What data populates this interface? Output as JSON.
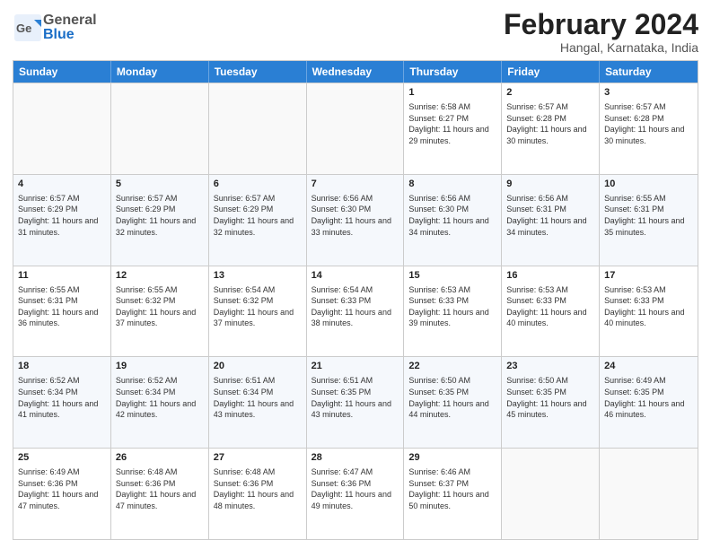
{
  "header": {
    "logo_general": "General",
    "logo_blue": "Blue",
    "month_title": "February 2024",
    "location": "Hangal, Karnataka, India"
  },
  "weekdays": [
    "Sunday",
    "Monday",
    "Tuesday",
    "Wednesday",
    "Thursday",
    "Friday",
    "Saturday"
  ],
  "rows": [
    [
      {
        "day": "",
        "info": ""
      },
      {
        "day": "",
        "info": ""
      },
      {
        "day": "",
        "info": ""
      },
      {
        "day": "",
        "info": ""
      },
      {
        "day": "1",
        "info": "Sunrise: 6:58 AM\nSunset: 6:27 PM\nDaylight: 11 hours and 29 minutes."
      },
      {
        "day": "2",
        "info": "Sunrise: 6:57 AM\nSunset: 6:28 PM\nDaylight: 11 hours and 30 minutes."
      },
      {
        "day": "3",
        "info": "Sunrise: 6:57 AM\nSunset: 6:28 PM\nDaylight: 11 hours and 30 minutes."
      }
    ],
    [
      {
        "day": "4",
        "info": "Sunrise: 6:57 AM\nSunset: 6:29 PM\nDaylight: 11 hours and 31 minutes."
      },
      {
        "day": "5",
        "info": "Sunrise: 6:57 AM\nSunset: 6:29 PM\nDaylight: 11 hours and 32 minutes."
      },
      {
        "day": "6",
        "info": "Sunrise: 6:57 AM\nSunset: 6:29 PM\nDaylight: 11 hours and 32 minutes."
      },
      {
        "day": "7",
        "info": "Sunrise: 6:56 AM\nSunset: 6:30 PM\nDaylight: 11 hours and 33 minutes."
      },
      {
        "day": "8",
        "info": "Sunrise: 6:56 AM\nSunset: 6:30 PM\nDaylight: 11 hours and 34 minutes."
      },
      {
        "day": "9",
        "info": "Sunrise: 6:56 AM\nSunset: 6:31 PM\nDaylight: 11 hours and 34 minutes."
      },
      {
        "day": "10",
        "info": "Sunrise: 6:55 AM\nSunset: 6:31 PM\nDaylight: 11 hours and 35 minutes."
      }
    ],
    [
      {
        "day": "11",
        "info": "Sunrise: 6:55 AM\nSunset: 6:31 PM\nDaylight: 11 hours and 36 minutes."
      },
      {
        "day": "12",
        "info": "Sunrise: 6:55 AM\nSunset: 6:32 PM\nDaylight: 11 hours and 37 minutes."
      },
      {
        "day": "13",
        "info": "Sunrise: 6:54 AM\nSunset: 6:32 PM\nDaylight: 11 hours and 37 minutes."
      },
      {
        "day": "14",
        "info": "Sunrise: 6:54 AM\nSunset: 6:33 PM\nDaylight: 11 hours and 38 minutes."
      },
      {
        "day": "15",
        "info": "Sunrise: 6:53 AM\nSunset: 6:33 PM\nDaylight: 11 hours and 39 minutes."
      },
      {
        "day": "16",
        "info": "Sunrise: 6:53 AM\nSunset: 6:33 PM\nDaylight: 11 hours and 40 minutes."
      },
      {
        "day": "17",
        "info": "Sunrise: 6:53 AM\nSunset: 6:33 PM\nDaylight: 11 hours and 40 minutes."
      }
    ],
    [
      {
        "day": "18",
        "info": "Sunrise: 6:52 AM\nSunset: 6:34 PM\nDaylight: 11 hours and 41 minutes."
      },
      {
        "day": "19",
        "info": "Sunrise: 6:52 AM\nSunset: 6:34 PM\nDaylight: 11 hours and 42 minutes."
      },
      {
        "day": "20",
        "info": "Sunrise: 6:51 AM\nSunset: 6:34 PM\nDaylight: 11 hours and 43 minutes."
      },
      {
        "day": "21",
        "info": "Sunrise: 6:51 AM\nSunset: 6:35 PM\nDaylight: 11 hours and 43 minutes."
      },
      {
        "day": "22",
        "info": "Sunrise: 6:50 AM\nSunset: 6:35 PM\nDaylight: 11 hours and 44 minutes."
      },
      {
        "day": "23",
        "info": "Sunrise: 6:50 AM\nSunset: 6:35 PM\nDaylight: 11 hours and 45 minutes."
      },
      {
        "day": "24",
        "info": "Sunrise: 6:49 AM\nSunset: 6:35 PM\nDaylight: 11 hours and 46 minutes."
      }
    ],
    [
      {
        "day": "25",
        "info": "Sunrise: 6:49 AM\nSunset: 6:36 PM\nDaylight: 11 hours and 47 minutes."
      },
      {
        "day": "26",
        "info": "Sunrise: 6:48 AM\nSunset: 6:36 PM\nDaylight: 11 hours and 47 minutes."
      },
      {
        "day": "27",
        "info": "Sunrise: 6:48 AM\nSunset: 6:36 PM\nDaylight: 11 hours and 48 minutes."
      },
      {
        "day": "28",
        "info": "Sunrise: 6:47 AM\nSunset: 6:36 PM\nDaylight: 11 hours and 49 minutes."
      },
      {
        "day": "29",
        "info": "Sunrise: 6:46 AM\nSunset: 6:37 PM\nDaylight: 11 hours and 50 minutes."
      },
      {
        "day": "",
        "info": ""
      },
      {
        "day": "",
        "info": ""
      }
    ]
  ]
}
